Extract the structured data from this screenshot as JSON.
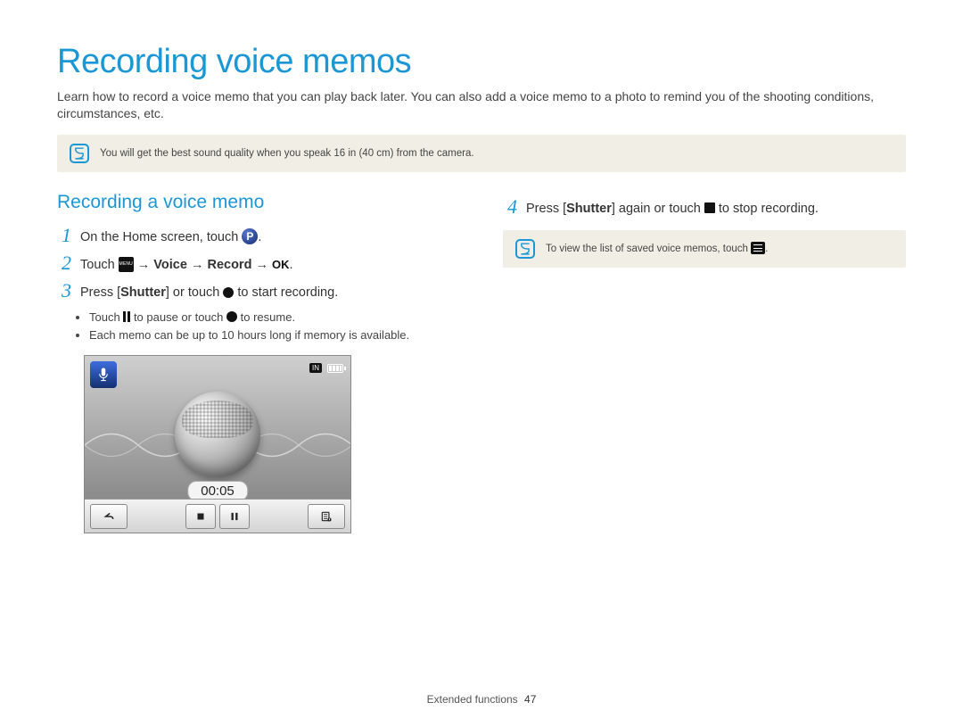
{
  "page": {
    "title": "Recording voice memos",
    "intro": "Learn how to record a voice memo that you can play back later. You can also add a voice memo to a photo to remind you of the shooting conditions, circumstances, etc."
  },
  "top_note": "You will get the best sound quality when you speak 16 in (40 cm) from the camera.",
  "section_heading": "Recording a voice memo",
  "steps": {
    "s1": {
      "num": "1",
      "a": "On the Home screen, touch ",
      "b": "."
    },
    "s2": {
      "num": "2",
      "a": "Touch ",
      "arrow": " → ",
      "voice": "Voice",
      "record": "Record",
      "b": "."
    },
    "s3": {
      "num": "3",
      "a": "Press [",
      "shutter": "Shutter",
      "b": "] or touch ",
      "c": " to start recording."
    },
    "s3_bullets": {
      "b1a": "Touch ",
      "b1b": " to pause or touch ",
      "b1c": " to resume.",
      "b2": "Each memo can be up to 10 hours long if memory is available."
    },
    "s4": {
      "num": "4",
      "a": "Press [",
      "shutter": "Shutter",
      "b": "] again or touch ",
      "c": " to stop recording."
    }
  },
  "right_note_a": "To view the list of saved voice memos, touch ",
  "right_note_b": ".",
  "device": {
    "in_badge": "IN",
    "timer": "00:05"
  },
  "icon_labels": {
    "p": "P",
    "menu": "MENU",
    "ok": "OK"
  },
  "footer": {
    "section": "Extended functions",
    "page": "47"
  }
}
